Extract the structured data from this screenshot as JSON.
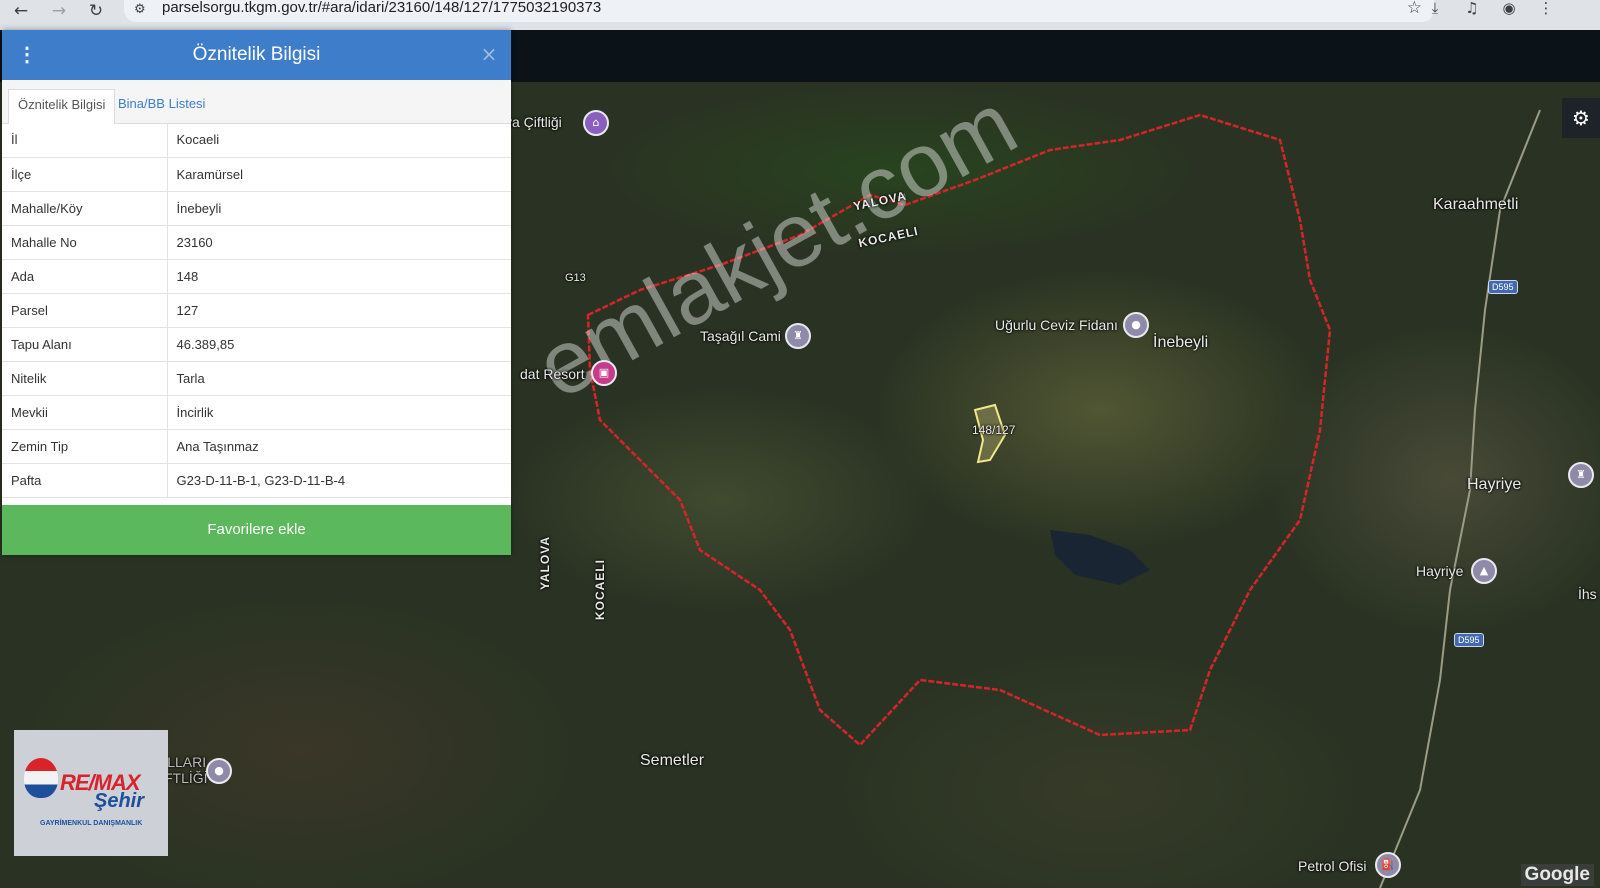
{
  "browser": {
    "url": "parselsorgu.tkgm.gov.tr/#ara/idari/23160/148/127/1775032190373",
    "icons": [
      "back-icon",
      "forward-icon",
      "reload-icon",
      "site-info-icon",
      "star-icon",
      "download-icon",
      "media-icon",
      "profile-icon",
      "menu-icon"
    ]
  },
  "panel": {
    "title": "Öznitelik Bilgisi",
    "close": "×",
    "tabs": [
      {
        "label": "Öznitelik Bilgisi",
        "active": true
      },
      {
        "label": "Bina/BB Listesi",
        "active": false
      }
    ],
    "rows": [
      {
        "key": "İl",
        "value": "Kocaeli"
      },
      {
        "key": "İlçe",
        "value": "Karamürsel"
      },
      {
        "key": "Mahalle/Köy",
        "value": "İnebeyli"
      },
      {
        "key": "Mahalle No",
        "value": "23160"
      },
      {
        "key": "Ada",
        "value": "148"
      },
      {
        "key": "Parsel",
        "value": "127"
      },
      {
        "key": "Tapu Alanı",
        "value": "46.389,85"
      },
      {
        "key": "Nitelik",
        "value": "Tarla"
      },
      {
        "key": "Mevkii",
        "value": "İncirlik"
      },
      {
        "key": "Zemin Tip",
        "value": "Ana Taşınmaz"
      },
      {
        "key": "Pafta",
        "value": "G23-D-11-B-1, G23-D-11-B-4"
      }
    ],
    "favorite_button": "Favorilere ekle",
    "header_color": "#3d7dca",
    "button_color": "#5cb85c"
  },
  "map": {
    "labels": {
      "ciftligi": "ya Çiftliği",
      "yalova_top": "YALOVA",
      "kocaeli_top": "KOCAELI",
      "g13": "G13",
      "tasagil": "Taşağıl Cami",
      "ugurlu": "Uğurlu Ceviz Fidanı",
      "inebeyli": "İnebeyli",
      "resort": "dat Resort",
      "karaahmetli": "Karaahmetli",
      "parcel": "148/127",
      "hayriye": "Hayriye",
      "hayriye2": "Hayriye",
      "yalova_side": "YALOVA",
      "kocaeli_side": "KOCAELI",
      "dumanogullari": "DUMANOĞULLARI",
      "ciftligi2": "ÇİFTLİĞİ",
      "semetler": "Semetler",
      "ihs": "İhs",
      "petrol": "Petrol Ofisi"
    },
    "route_badges": [
      "D595",
      "D595"
    ],
    "watermark": "emlakjet.com",
    "attribution": "Google",
    "boundary_color": "#d4252a"
  },
  "logo": {
    "brand": "RE/MAX",
    "sub": "Şehir",
    "tagline": "GAYRİMENKUL DANIŞMANLIK",
    "balloon_text": "RE/MAX"
  }
}
